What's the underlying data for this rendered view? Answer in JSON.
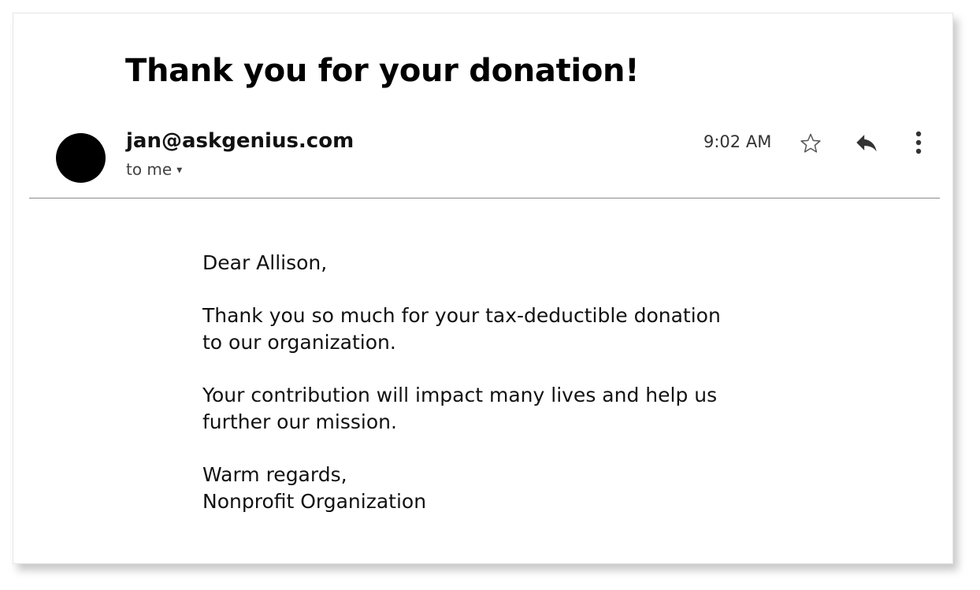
{
  "email": {
    "subject": "Thank you for your donation!",
    "sender": "jan@askgenius.com",
    "recipient_label": "to me",
    "recipient_caret": "▾",
    "time": "9:02 AM",
    "icons": {
      "avatar": "avatar",
      "star": "star-icon",
      "reply": "reply-icon",
      "more": "more-vertical-icon"
    },
    "body": {
      "greeting": "Dear Allison,",
      "para1_line1": "Thank you so much for your tax-deductible donation",
      "para1_line2": "to our organization.",
      "para2_line1": "Your contribution will impact many lives and help us",
      "para2_line2": "further our mission.",
      "closing": "Warm regards,",
      "signature": "Nonprofit Organization"
    }
  }
}
